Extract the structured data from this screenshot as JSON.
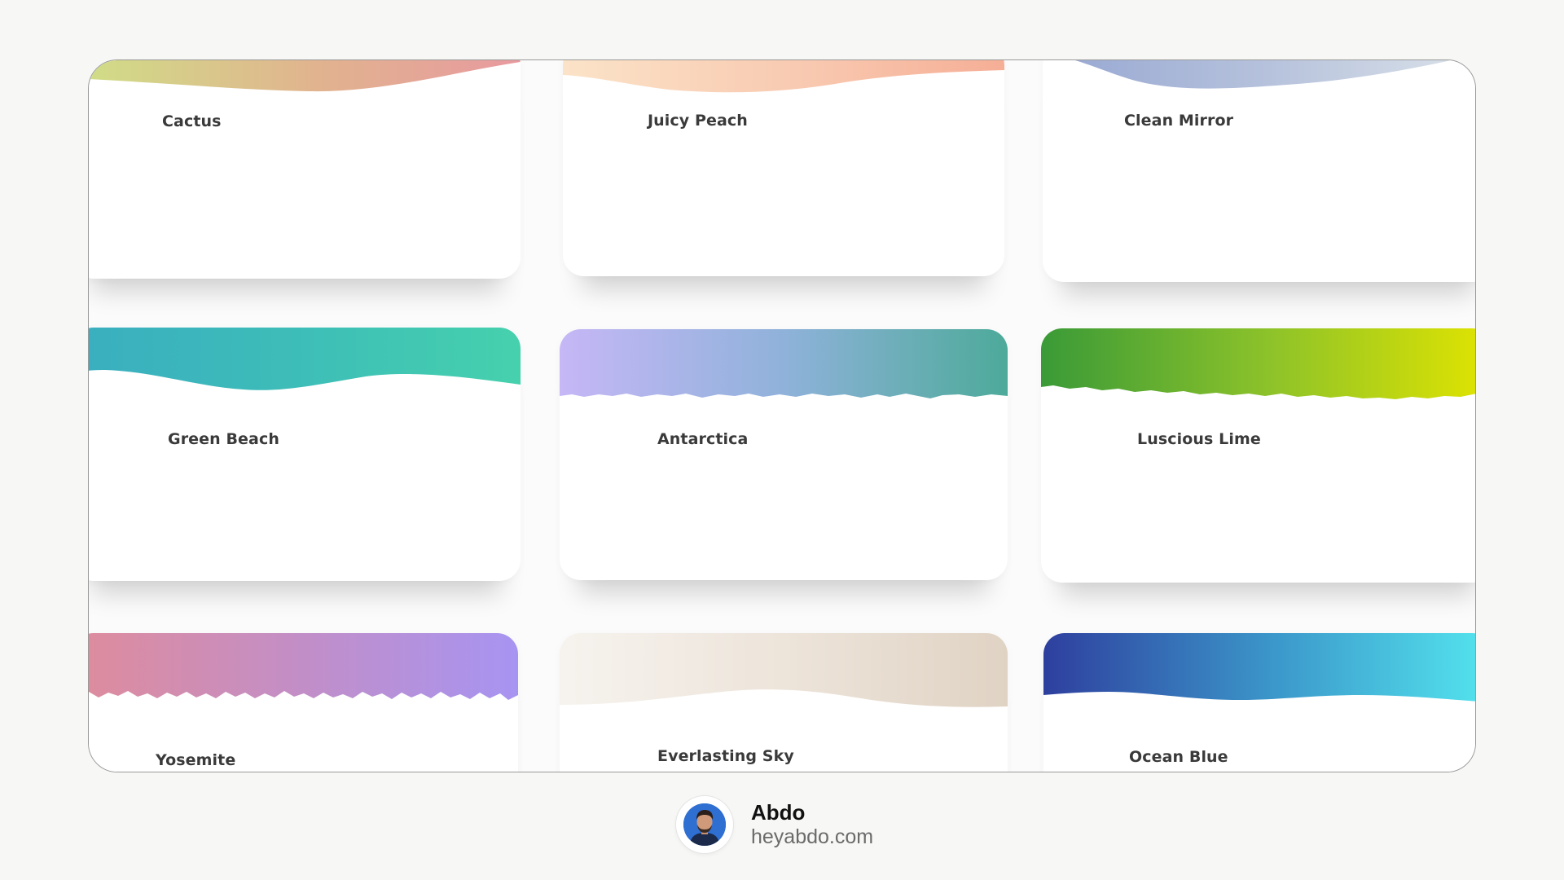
{
  "cards": [
    {
      "name": "Cactus",
      "gradient": [
        "#cfdf86",
        "#e1b38f",
        "#e89a9f"
      ]
    },
    {
      "name": "Juicy Peach",
      "gradient": [
        "#fbe3c8",
        "#f8c9b0",
        "#f6ae96"
      ]
    },
    {
      "name": "Clean Mirror",
      "gradient": [
        "#96a6d2",
        "#b6c2dc",
        "#dde4ea"
      ]
    },
    {
      "name": "Green Beach",
      "gradient": [
        "#3aaec0",
        "#3dbdb8",
        "#46d1ad"
      ]
    },
    {
      "name": "Antarctica",
      "gradient": [
        "#c6b7f6",
        "#8fb2da",
        "#4daa9a"
      ]
    },
    {
      "name": "Luscious Lime",
      "gradient": [
        "#3a9a37",
        "#8cc22a",
        "#e2e400"
      ]
    },
    {
      "name": "Yosemite",
      "gradient": [
        "#df8c9b",
        "#c38ec6",
        "#a794f2"
      ]
    },
    {
      "name": "Everlasting Sky",
      "gradient": [
        "#f6f3ee",
        "#ede4da",
        "#e0d3c4"
      ]
    },
    {
      "name": "Ocean Blue",
      "gradient": [
        "#2e3f9e",
        "#3b95c9",
        "#54e6ef"
      ]
    }
  ],
  "credit": {
    "name": "Abdo",
    "site": "heyabdo.com",
    "avatar_icon": "person-avatar-icon"
  },
  "colors": {
    "background": "#f7f7f5",
    "frame_border": "#9a9a9a",
    "label_text": "#3a3a3a"
  }
}
